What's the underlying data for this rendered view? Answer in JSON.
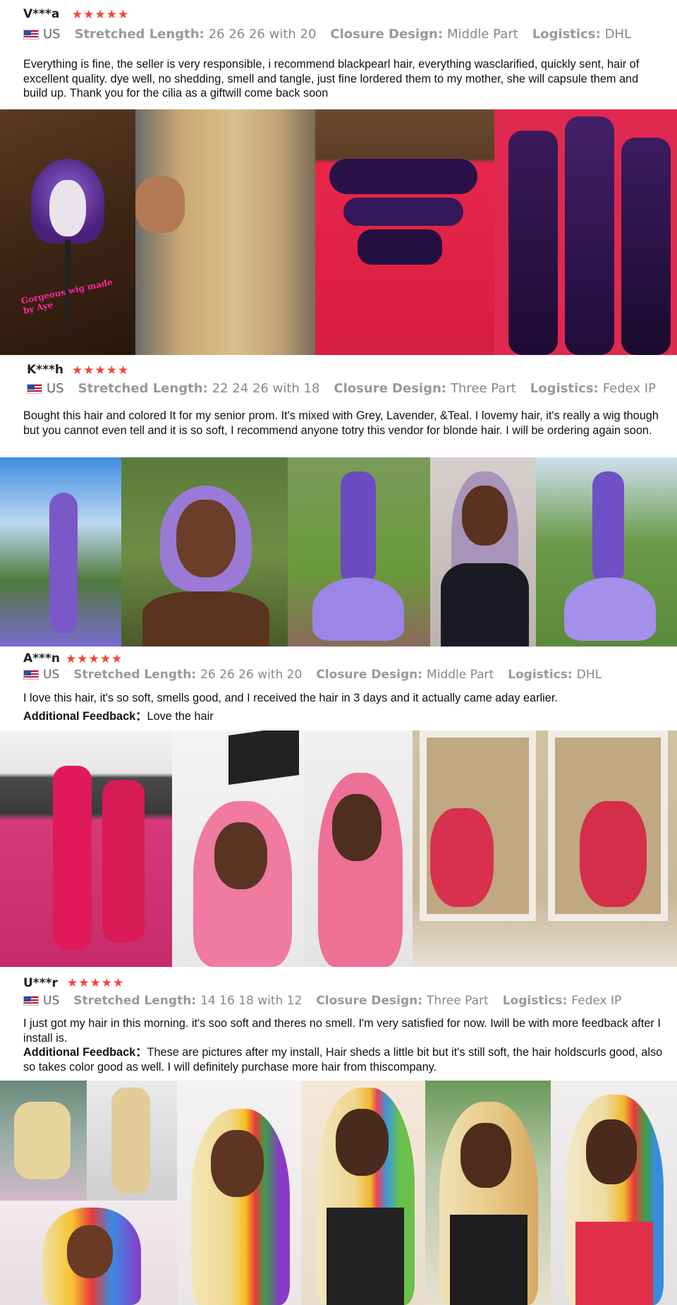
{
  "reviews": [
    {
      "user": "V***a",
      "rating": 5,
      "country": "US",
      "length_label": "Stretched Length:",
      "length_value": "26 26 26 with 20",
      "closure_label": "Closure Design:",
      "closure_value": "Middle Part",
      "logistics_label": "Logistics:",
      "logistics_value": "DHL",
      "text": "Everything is fine, the seller is very responsible, i recommend blackpearl hair, everything wasclarified, quickly sent, hair of excellent quality. dye well, no shedding, smell and tangle, just fine lordered them to my mother, she will capsule them and build up. Thank you for the cilia as a giftwill come back soon",
      "photo_overlay": "Gorgeous wig made by Aye"
    },
    {
      "user": "K***h",
      "rating": 5,
      "country": "US",
      "length_label": "Stretched Length:",
      "length_value": "22 24 26 with 18",
      "closure_label": "Closure Design:",
      "closure_value": "Three Part",
      "logistics_label": "Logistics:",
      "logistics_value": "Fedex IP",
      "text": "Bought this hair and colored It for my senior prom. It's mixed with Grey, Lavender, &Teal. I lovemy hair, it's really a wig though but you cannot even tell and it is so soft, I recommend anyone totry this vendor for blonde hair. I will be ordering again soon."
    },
    {
      "user": "A***n",
      "rating": 5,
      "country": "US",
      "length_label": "Stretched Length:",
      "length_value": "26 26 26 with 20",
      "closure_label": "Closure Design:",
      "closure_value": "Middle Part",
      "logistics_label": "Logistics:",
      "logistics_value": "DHL",
      "text": "I love this hair, it's so soft, smells good, and I received the hair in 3 days and it actually came aday earlier.",
      "additional_label": "Additional Feedback：",
      "additional_text": "Love the hair"
    },
    {
      "user": "U***r",
      "rating": 5,
      "country": "US",
      "length_label": "Stretched Length:",
      "length_value": "14 16 18 with 12",
      "closure_label": "Closure Design:",
      "closure_value": "Three Part",
      "logistics_label": "Logistics:",
      "logistics_value": "Fedex IP",
      "text": "I just got my hair in this morning. it's soo soft and theres no smell. I'm very satisfied for now. Iwill be with more feedback after I install is.",
      "additional_label": "Additional Feedback：",
      "additional_text": "These are pictures after my install, Hair sheds a little bit but it's still soft, the hair holdscurls good, also so takes color good as well. I will definitely purchase more hair from thiscompany."
    }
  ],
  "colors": {
    "star": "#f44336",
    "meta_key": "#999999",
    "meta_value": "#888888",
    "text": "#111111"
  },
  "icons": [
    "star-icon",
    "us-flag-icon"
  ]
}
